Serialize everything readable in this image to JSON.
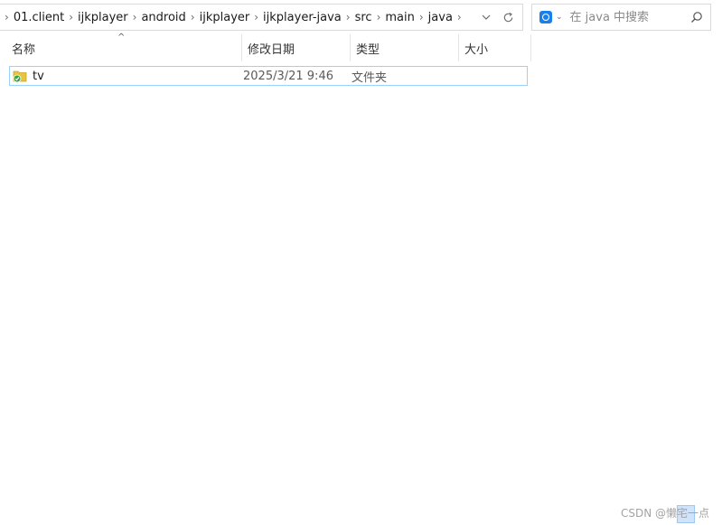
{
  "breadcrumb": [
    "01.client",
    "ijkplayer",
    "android",
    "ijkplayer",
    "ijkplayer-java",
    "src",
    "main",
    "java"
  ],
  "search": {
    "placeholder": "在 java 中搜索"
  },
  "columns": {
    "name": "名称",
    "date": "修改日期",
    "type": "类型",
    "size": "大小"
  },
  "files": [
    {
      "name": "tv",
      "modified": "2025/3/21 9:46",
      "type": "文件夹",
      "size": ""
    }
  ],
  "watermark": "CSDN @懒宅一点",
  "colors": {
    "accent": "#1a7fe8",
    "selection_border": "#99d1ff",
    "folder": "#e8c33f",
    "sync_badge": "#3aa33a"
  }
}
